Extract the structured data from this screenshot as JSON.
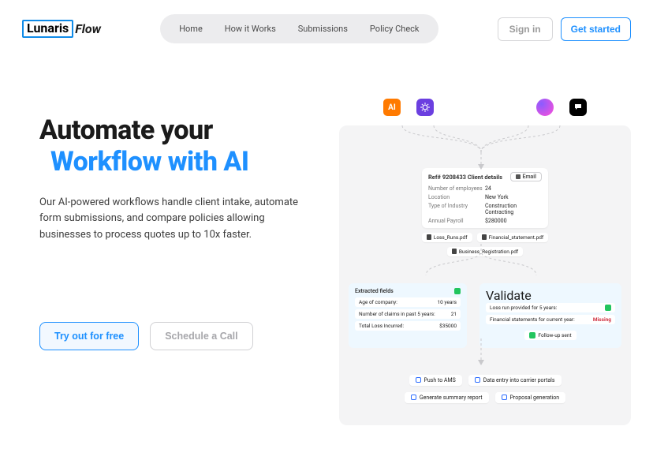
{
  "brand": {
    "boxed": "Lunaris",
    "rest": "Flow"
  },
  "nav": {
    "items": [
      "Home",
      "How it Works",
      "Submissions",
      "Policy Check"
    ]
  },
  "header_actions": {
    "signin": "Sign in",
    "get_started": "Get started"
  },
  "hero": {
    "line1": "Automate your",
    "line2": "Workflow with AI",
    "desc": "Our AI-powered workflows handle client intake, automate form submissions, and compare policies allowing businesses to process quotes up to 10x faster.",
    "cta_primary": "Try out for free",
    "cta_secondary": "Schedule a Call"
  },
  "diagram": {
    "sources": [
      "ai-icon",
      "openai-icon",
      "gradient-icon",
      "chat-icon"
    ],
    "client_card": {
      "title": "Ref# 9208433 Client details",
      "email_btn": "Email",
      "rows": [
        {
          "k": "Number of employees",
          "v": "24"
        },
        {
          "k": "Location",
          "v": "New York"
        },
        {
          "k": "Type of Industry",
          "v": "Construction Contracting"
        },
        {
          "k": "Annual Payroll",
          "v": "$280000"
        }
      ]
    },
    "files": [
      "Loss_Runs.pdf",
      "Financial_statement.pdf",
      "Business_Registration.pdf"
    ],
    "extracted": {
      "title": "Extracted fields",
      "rows": [
        {
          "k": "Age of company:",
          "v": "10 years"
        },
        {
          "k": "Number of claims in past 5 years:",
          "v": "21"
        },
        {
          "k": "Total Loss Incurred:",
          "v": "$35000"
        }
      ]
    },
    "validate": {
      "title": "Validate",
      "rows": [
        {
          "k": "Loss run provided for 5 years:",
          "v": "ok"
        },
        {
          "k": "Financial statements for current year:",
          "v": "Missing"
        }
      ],
      "followup": "Follow-up sent"
    },
    "outputs": [
      "Push to AMS",
      "Data entry into carrier portals",
      "Generate summary report",
      "Proposal generation"
    ]
  }
}
